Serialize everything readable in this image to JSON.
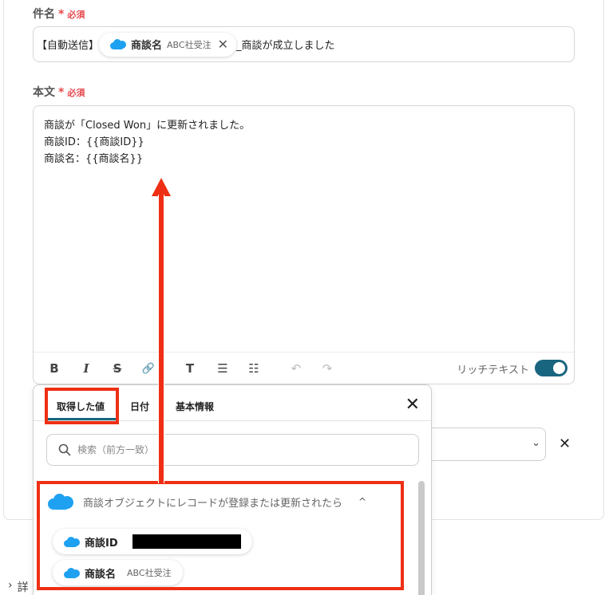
{
  "subject": {
    "label": "件名",
    "required_mark": "*",
    "required_text": "必須",
    "prefix": "【自動送信】",
    "chip": {
      "name": "商談名",
      "sub": "ABC社受注",
      "icon": "salesforce-cloud-icon"
    },
    "suffix": "_商談が成立しました"
  },
  "body": {
    "label": "本文",
    "required_mark": "*",
    "required_text": "必須",
    "lines": [
      "商談が「Closed Won」に更新されました。",
      "商談ID：{{商談ID}}",
      "商談名：{{商談名}}"
    ],
    "toolbar": {
      "bold": "B",
      "italic": "I",
      "strike": "S",
      "link": "🔗",
      "text_size": "T",
      "bullet_list": "☰",
      "numbered_list": "☷",
      "undo": "↶",
      "redo": "↷",
      "rich_text_label": "リッチテキスト"
    }
  },
  "popup": {
    "tabs": [
      {
        "label": "取得した値"
      },
      {
        "label": "日付"
      },
      {
        "label": "基本情報"
      }
    ],
    "close": "✕",
    "search_placeholder": "検索（前方一致）",
    "group_title": "商談オブジェクトにレコードが登録または更新されたら",
    "group_chevron": "^",
    "items": [
      {
        "name": "商談ID"
      },
      {
        "name": "商談名",
        "sub": "ABC社受注"
      }
    ]
  },
  "background": {
    "select_chevron": "⌄",
    "close": "✕"
  },
  "detail": {
    "chevron": "›",
    "label": "詳"
  },
  "colors": {
    "accent": "#18657f",
    "required": "#e5484d",
    "highlight": "#ee2f14",
    "salesforce": "#1ea1f1"
  }
}
